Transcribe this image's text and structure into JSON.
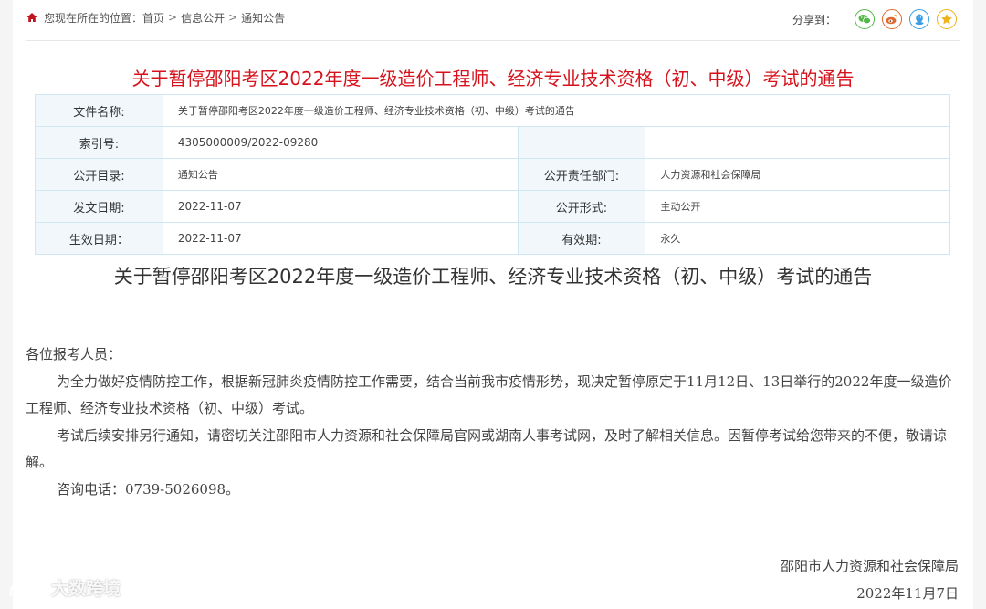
{
  "breadcrumb": {
    "prefix": "您现在所在的位置：",
    "items": [
      "首页",
      "信息公开",
      "通知公告"
    ],
    "separator": ">"
  },
  "share": {
    "label": "分享到：",
    "buttons": [
      {
        "icon": "wechat-icon",
        "color": "#56b64a"
      },
      {
        "icon": "weibo-icon",
        "color": "#e0682e"
      },
      {
        "icon": "qq-icon",
        "color": "#3a9ee2"
      },
      {
        "icon": "qzone-star-icon",
        "color": "#f0b21a"
      }
    ]
  },
  "title_red": "关于暂停邵阳考区2022年度一级造价工程师、经济专业技术资格（初、中级）考试的通告",
  "meta": {
    "file_name_label": "文件名称:",
    "file_name_value": "关于暂停邵阳考区2022年度一级造价工程师、经济专业技术资格（初、中级）考试的通告",
    "index_label": "索引号:",
    "index_value": "4305000009/2022-09280",
    "catalog_label": "公开目录:",
    "catalog_value": "通知公告",
    "dept_label": "公开责任部门:",
    "dept_value": "人力资源和社会保障局",
    "issue_date_label": "发文日期:",
    "issue_date_value": "2022-11-07",
    "form_label": "公开形式:",
    "form_value": "主动公开",
    "effective_date_label": "生效日期：",
    "effective_date_value": "2022-11-07",
    "validity_label": "有效期:",
    "validity_value": "永久"
  },
  "title_black": "关于暂停邵阳考区2022年度一级造价工程师、经济专业技术资格（初、中级）考试的通告",
  "article": {
    "greeting": "各位报考人员：",
    "p1": "为全力做好疫情防控工作，根据新冠肺炎疫情防控工作需要，结合当前我市疫情形势，现决定暂停原定于11月12日、13日举行的2022年度一级造价工程师、经济专业技术资格（初、中级）考试。",
    "p2": "考试后续安排另行通知，请密切关注邵阳市人力资源和社会保障局官网或湖南人事考试网，及时了解相关信息。因暂停考试给您带来的不便，敬请谅解。",
    "p3": "咨询电话：0739-5026098。"
  },
  "signature": {
    "org": "邵阳市人力资源和社会保障局",
    "date": "2022年11月7日"
  },
  "watermark": {
    "text": "大数跨境"
  },
  "colors": {
    "title_red": "#d6121c",
    "table_border": "#cfe6f3",
    "label_bg": "#f2f7fb",
    "home_icon": "#c0151d"
  }
}
